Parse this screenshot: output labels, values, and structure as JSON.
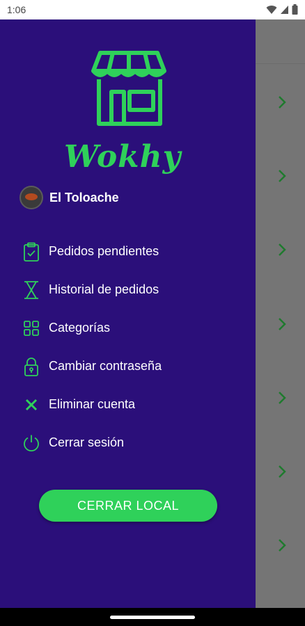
{
  "status_bar": {
    "time": "1:06",
    "icons": [
      "wifi-icon",
      "signal-icon",
      "battery-icon"
    ]
  },
  "brand": {
    "name": "Wokhy",
    "color": "#2fd15a",
    "logo_icon": "store-icon"
  },
  "drawer": {
    "background": "#2b0f7a",
    "store_name": "El Toloache",
    "menu": [
      {
        "label": "Pedidos pendientes",
        "icon": "clipboard-check-icon"
      },
      {
        "label": "Historial de pedidos",
        "icon": "hourglass-icon"
      },
      {
        "label": "Categorías",
        "icon": "grid-icon"
      },
      {
        "label": "Cambiar contraseña",
        "icon": "lock-icon"
      },
      {
        "label": "Eliminar cuenta",
        "icon": "close-icon"
      },
      {
        "label": "Cerrar sesión",
        "icon": "power-icon"
      }
    ],
    "close_store_button": "CERRAR LOCAL"
  },
  "background_list": {
    "chevron_icon": "chevron-right-icon",
    "row_count": 7
  }
}
